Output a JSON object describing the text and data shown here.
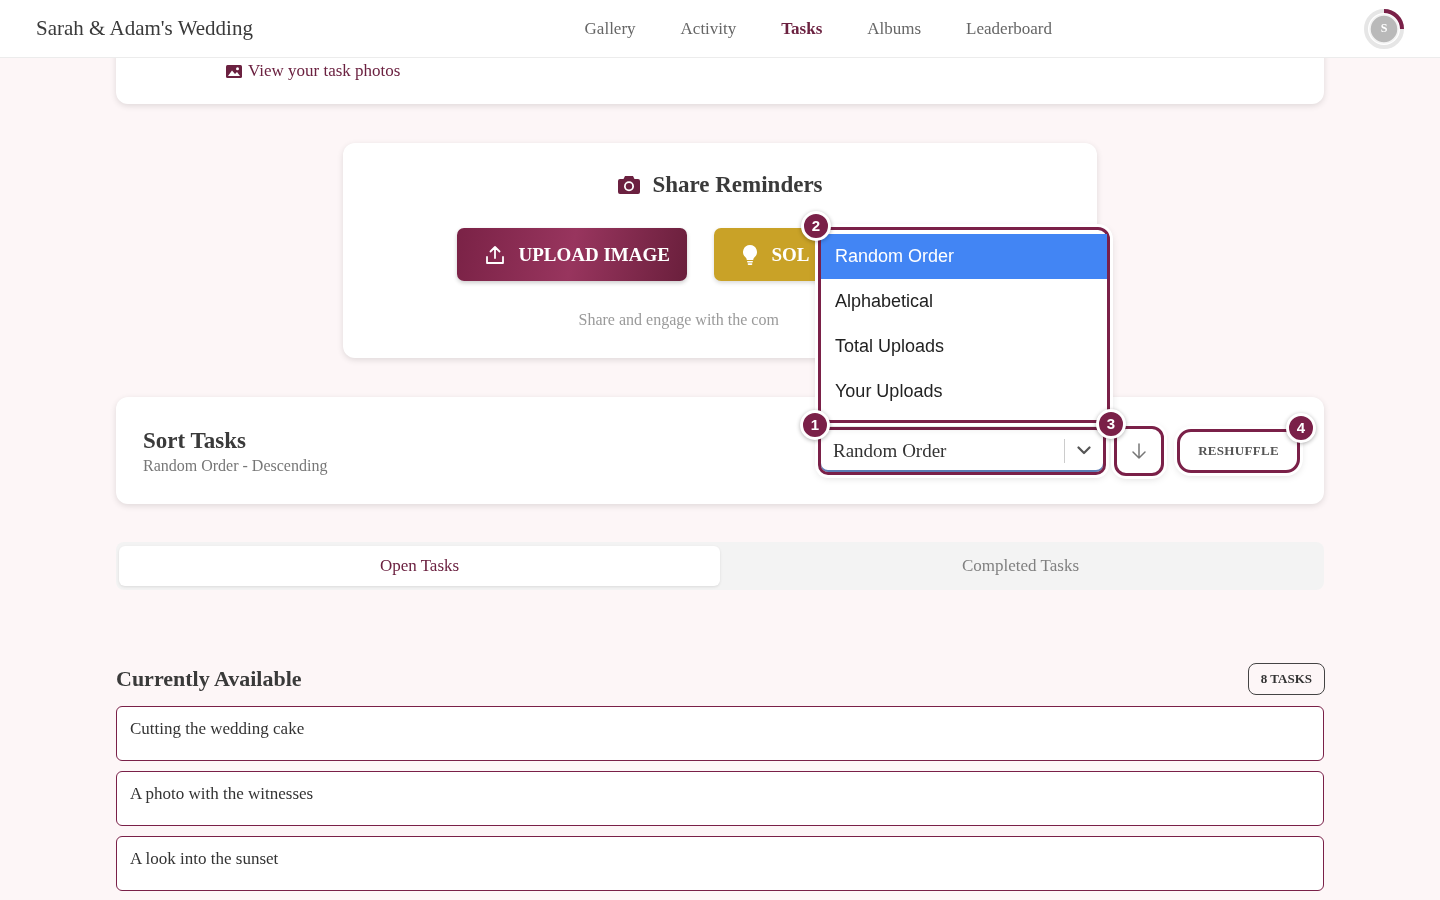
{
  "header": {
    "title": "Sarah & Adam's Wedding",
    "nav": [
      {
        "label": "Gallery",
        "selected": false
      },
      {
        "label": "Activity",
        "selected": false
      },
      {
        "label": "Tasks",
        "selected": true
      },
      {
        "label": "Albums",
        "selected": false
      },
      {
        "label": "Leaderboard",
        "selected": false
      }
    ],
    "avatar": {
      "initial": "S"
    }
  },
  "progress_card": {
    "photos_link": "View your task photos"
  },
  "share_card": {
    "title": "Share Reminders",
    "buttons": [
      {
        "kind": "upload",
        "label": "UPLOAD IMAGE"
      },
      {
        "kind": "idea",
        "label": "SOL"
      }
    ],
    "subtitle": "Share and engage with the com"
  },
  "sort_card": {
    "title": "Sort Tasks",
    "summary": "Random Order - Descending",
    "select": {
      "value": "Random Order",
      "marker": "1"
    },
    "options_marker": "2",
    "options": [
      {
        "label": "Random Order",
        "selected": true
      },
      {
        "label": "Alphabetical",
        "selected": false
      },
      {
        "label": "Total Uploads",
        "selected": false
      },
      {
        "label": "Your Uploads",
        "selected": false
      }
    ],
    "descending": true,
    "direction_marker": "3",
    "reshuffle": {
      "label": "RESHUFFLE",
      "marker": "4"
    }
  },
  "tabs": [
    {
      "label": "Open Tasks",
      "selected": true
    },
    {
      "label": "Completed Tasks",
      "selected": false
    }
  ],
  "section": {
    "title": "Currently Available",
    "count": "8 TASKS"
  },
  "tasks": [
    {
      "title": "Cutting the wedding cake"
    },
    {
      "title": "A photo with the witnesses"
    },
    {
      "title": "A look into the sunset"
    }
  ]
}
